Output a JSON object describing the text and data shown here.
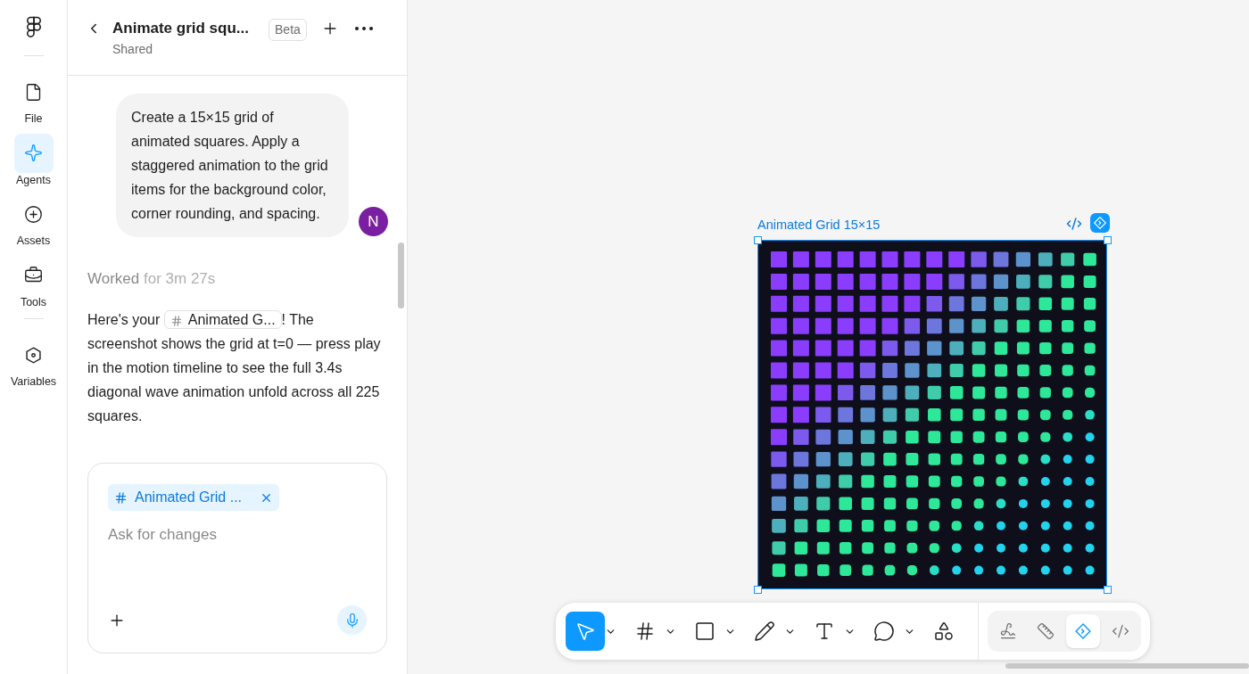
{
  "rail": {
    "items": [
      {
        "label": "File",
        "selected": false
      },
      {
        "label": "Agents",
        "selected": true
      },
      {
        "label": "Assets",
        "selected": false
      },
      {
        "label": "Tools",
        "selected": false
      },
      {
        "label": "Variables",
        "selected": false
      }
    ]
  },
  "chat": {
    "title": "Animate grid squ...",
    "subtitle": "Shared",
    "badge": "Beta",
    "user_message": {
      "text": "Create a 15×15 grid of animated squares. Apply a staggered animation to the grid items for the background color, corner rounding, and spacing.",
      "avatar": "N"
    },
    "worked": {
      "label": "Worked",
      "duration": "for 3m 27s"
    },
    "reply": {
      "before": "Here's your",
      "chip": "Animated G...",
      "after": "! The screenshot shows the grid at t=0 — press play in the motion timeline to see the full 3.4s diagonal wave animation unfold across all 225 squares."
    },
    "composer": {
      "chip": "Animated Grid ...",
      "placeholder": "Ask for changes"
    }
  },
  "canvas": {
    "frame": {
      "title": "Animated Grid 15×15",
      "selected": true
    }
  },
  "toolbar": {
    "tools": [
      {
        "kind": "split",
        "selected": true
      },
      {
        "kind": "split",
        "selected": false
      },
      {
        "kind": "split",
        "selected": false
      },
      {
        "kind": "split",
        "selected": false
      },
      {
        "kind": "split",
        "selected": false
      },
      {
        "kind": "split",
        "selected": false
      },
      {
        "kind": "single",
        "selected": false
      }
    ],
    "modes": [
      {
        "selected": false
      },
      {
        "selected": false
      },
      {
        "selected": true
      },
      {
        "selected": false
      }
    ]
  }
}
